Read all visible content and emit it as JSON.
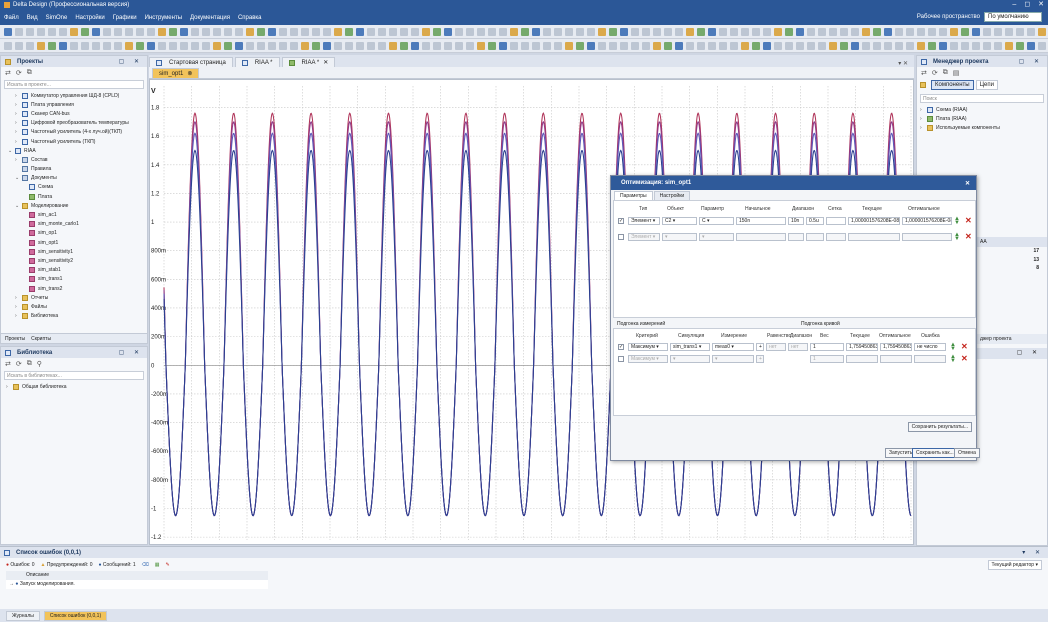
{
  "window": {
    "title": "Delta Design (Профессиональная версия)",
    "controls": [
      "–",
      "◻",
      "✕"
    ]
  },
  "menu": {
    "items": [
      "Файл",
      "Вид",
      "SimOne",
      "Настройки",
      "Графики",
      "Инструменты",
      "Документация",
      "Справка"
    ],
    "workspace_label": "Рабочее пространство",
    "workspace_value": "По умолчанию"
  },
  "projects": {
    "title": "Проекты",
    "search_placeholder": "Искать в проекте...",
    "items": [
      {
        "label": "Коммутатор управления ШД-8 (CPLD)",
        "indent": 2,
        "arrow": "›",
        "icon": "s"
      },
      {
        "label": "Плата управления",
        "indent": 2,
        "arrow": "›",
        "icon": "s"
      },
      {
        "label": "Сканер CAN-bus",
        "indent": 2,
        "arrow": "›",
        "icon": "s"
      },
      {
        "label": "Цифровой преобразователь температуры",
        "indent": 2,
        "arrow": "›",
        "icon": "s"
      },
      {
        "label": "Частотный усилитель (4-х луч.ой)(ТКП)",
        "indent": 2,
        "arrow": "›",
        "icon": "s"
      },
      {
        "label": "Частотный усилитель (ТКП)",
        "indent": 2,
        "arrow": "›",
        "icon": "s"
      },
      {
        "label": "RIAA",
        "indent": 1,
        "arrow": "⌄",
        "icon": "s"
      },
      {
        "label": "Состав",
        "indent": 2,
        "arrow": "›",
        "icon": "d"
      },
      {
        "label": "Правила",
        "indent": 2,
        "arrow": "",
        "icon": "d"
      },
      {
        "label": "Документы",
        "indent": 2,
        "arrow": "⌄",
        "icon": "d"
      },
      {
        "label": "Схема",
        "indent": 3,
        "arrow": "",
        "icon": "s"
      },
      {
        "label": "Плата",
        "indent": 3,
        "arrow": "",
        "icon": "g"
      },
      {
        "label": "Моделирование",
        "indent": 2,
        "arrow": "⌄",
        "icon": "f"
      },
      {
        "label": "sim_ac1",
        "indent": 3,
        "arrow": "",
        "icon": "p"
      },
      {
        "label": "sim_monte_carlo1",
        "indent": 3,
        "arrow": "",
        "icon": "p"
      },
      {
        "label": "sim_op1",
        "indent": 3,
        "arrow": "",
        "icon": "p"
      },
      {
        "label": "sim_opt1",
        "indent": 3,
        "arrow": "",
        "icon": "p"
      },
      {
        "label": "sim_sensitivity1",
        "indent": 3,
        "arrow": "",
        "icon": "p"
      },
      {
        "label": "sim_sensitivity2",
        "indent": 3,
        "arrow": "",
        "icon": "p"
      },
      {
        "label": "sim_stab1",
        "indent": 3,
        "arrow": "",
        "icon": "p"
      },
      {
        "label": "sim_trans1",
        "indent": 3,
        "arrow": "",
        "icon": "p"
      },
      {
        "label": "sim_trans2",
        "indent": 3,
        "arrow": "",
        "icon": "p"
      },
      {
        "label": "Отчеты",
        "indent": 2,
        "arrow": "›",
        "icon": "f"
      },
      {
        "label": "Файлы",
        "indent": 2,
        "arrow": "›",
        "icon": "f"
      },
      {
        "label": "Библиотека",
        "indent": 2,
        "arrow": "›",
        "icon": "f"
      }
    ],
    "bottom_tabs": [
      "Проекты",
      "Скрипты"
    ]
  },
  "library": {
    "title": "Библиотека",
    "search_placeholder": "Искать в библиотеках...",
    "item": "Общая библиотека"
  },
  "doc_tabs": [
    {
      "label": "Стартовая страница",
      "active": false
    },
    {
      "label": "RIAA *",
      "active": false
    },
    {
      "label": "RIAA *",
      "active": false
    }
  ],
  "active_doc_tab": "sim_opt1",
  "chart_data": {
    "type": "line",
    "ylabel": "V",
    "y_ticks": [
      {
        "label": "1.8",
        "v": 1.8
      },
      {
        "label": "1.6",
        "v": 1.6
      },
      {
        "label": "1.4",
        "v": 1.4
      },
      {
        "label": "1.2",
        "v": 1.2
      },
      {
        "label": "1",
        "v": 1.0
      },
      {
        "label": "800m",
        "v": 0.8
      },
      {
        "label": "600m",
        "v": 0.6
      },
      {
        "label": "400m",
        "v": 0.4
      },
      {
        "label": "200m",
        "v": 0.2
      },
      {
        "label": "0",
        "v": 0
      },
      {
        "label": "-200m",
        "v": -0.2
      },
      {
        "label": "-400m",
        "v": -0.4
      },
      {
        "label": "-600m",
        "v": -0.6
      },
      {
        "label": "-800m",
        "v": -0.8
      },
      {
        "label": "-1",
        "v": -1.0
      },
      {
        "label": "-1.2",
        "v": -1.2
      }
    ],
    "ylim": [
      -1.22,
      1.95
    ],
    "periods_visible": 19.3,
    "series": [
      {
        "amplitude": 1.76,
        "color": "#b0355a"
      },
      {
        "amplitude": 1.7,
        "color": "#8e3a8a"
      },
      {
        "amplitude": 1.62,
        "color": "#5a58b8"
      },
      {
        "amplitude": 1.5,
        "color": "#2a3f8f"
      }
    ]
  },
  "manager": {
    "title": "Менеджер проекта",
    "tabs": [
      "Компоненты",
      "Цепи"
    ],
    "search_placeholder": "Поиск",
    "items": [
      "Схема (RIAA)",
      "Плата (RIAA)",
      "Используемые компоненты"
    ],
    "section_label": "AA",
    "counts": [
      "17",
      "13",
      "8"
    ],
    "bottom_tab": "джер проекта"
  },
  "dialog": {
    "title": "Оптимизация: sim_opt1",
    "tabs": [
      "Параметры",
      "Настройки"
    ],
    "param_headers": [
      "Тип",
      "Объект",
      "Параметр",
      "Начальное",
      "Диапазон",
      "Сетка",
      "Текущее",
      "Оптимальное"
    ],
    "param_rows": [
      {
        "checked": true,
        "type": "Элемент",
        "object": "C2",
        "param": "C",
        "start": "150n",
        "range": "10n",
        "grid": "0.5u",
        "current": "1,000001576208E-08",
        "optimal": "1,000001576208E-08"
      }
    ],
    "meas_section": "Подгонка измерений",
    "curve_section": "Подгонка кривой",
    "meas_headers": [
      "Критерий",
      "Симуляция",
      "Измерение",
      "Равенство",
      "Диапазон",
      "Вес",
      "Текущее",
      "Оптимальное",
      "Ошибка"
    ],
    "meas_rows": [
      {
        "checked": true,
        "criterion": "Максимум",
        "sim": "sim_trans1",
        "meas": "meas0",
        "eq": "нет",
        "range": "нет",
        "weight": "1",
        "current": "1,759450863E",
        "optimal": "1,759450863E",
        "error": "не число"
      }
    ],
    "meas_empty_criterion": "Максимум",
    "meas_empty_weight": "1",
    "save_results": "Сохранить результаты...",
    "buttons": {
      "run": "Запустить",
      "save_as": "Сохранить как...",
      "cancel": "Отмена"
    }
  },
  "errors": {
    "title": "Список ошибок (0,0,1)",
    "filters": [
      "Ошибок: 0",
      "Предупреждений: 0",
      "Сообщений: 1"
    ],
    "column": "Описание",
    "message": "Запуск моделирования.",
    "editor": "Текущий редактор"
  },
  "status_tabs": [
    "Журналы",
    "Список ошибок (0,0,1)"
  ]
}
